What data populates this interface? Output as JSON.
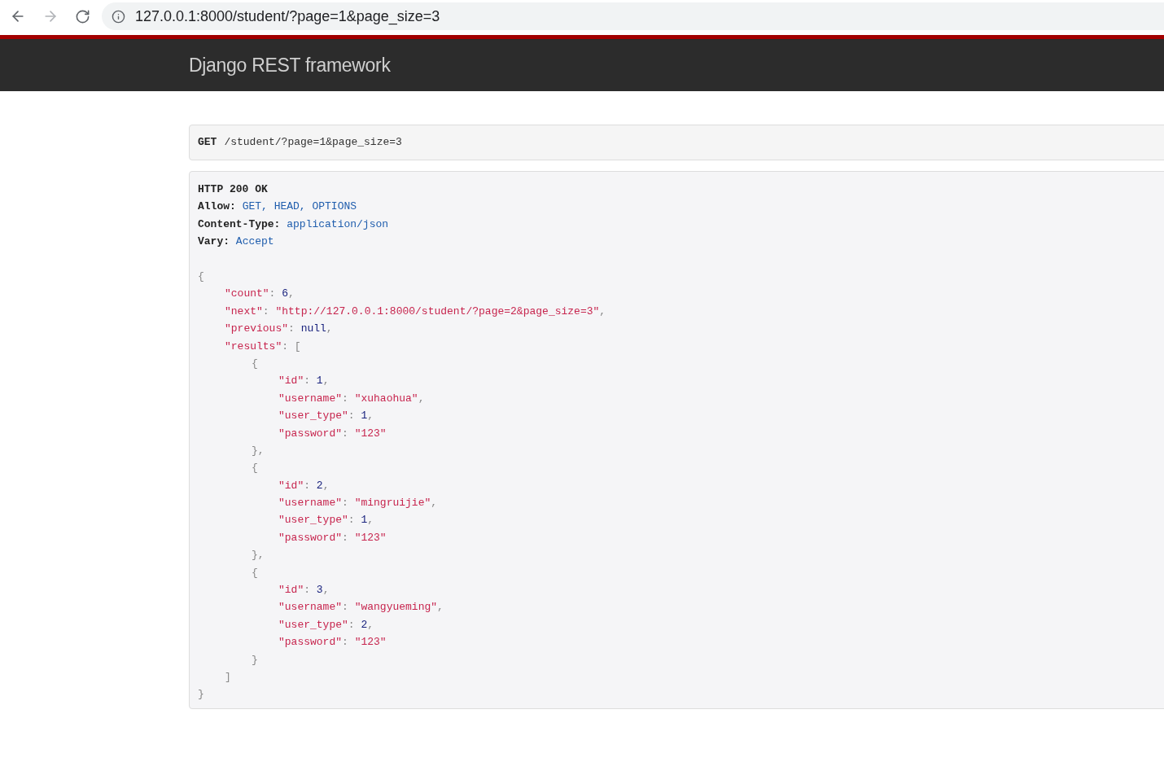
{
  "browser": {
    "url": "127.0.0.1:8000/student/?page=1&page_size=3"
  },
  "navbar": {
    "brand": "Django REST framework"
  },
  "request": {
    "method": "GET",
    "path": "/student/?page=1&page_size=3"
  },
  "response": {
    "status": "HTTP 200 OK",
    "headers": [
      {
        "name": "Allow:",
        "value": "GET, HEAD, OPTIONS"
      },
      {
        "name": "Content-Type:",
        "value": "application/json"
      },
      {
        "name": "Vary:",
        "value": "Accept"
      }
    ],
    "body": [
      {
        "tokens": [
          {
            "t": "{",
            "kind": "punct"
          }
        ],
        "children": [
          {
            "tokens": [
              {
                "t": "\"count\"",
                "kind": "key"
              },
              {
                "t": ": ",
                "kind": "punct"
              },
              {
                "t": "6",
                "kind": "num"
              },
              {
                "t": ",",
                "kind": "punct"
              }
            ]
          },
          {
            "tokens": [
              {
                "t": "\"next\"",
                "kind": "key"
              },
              {
                "t": ": ",
                "kind": "punct"
              },
              {
                "t": "\"http://127.0.0.1:8000/student/?page=2&page_size=3\"",
                "kind": "str"
              },
              {
                "t": ",",
                "kind": "punct"
              }
            ]
          },
          {
            "tokens": [
              {
                "t": "\"previous\"",
                "kind": "key"
              },
              {
                "t": ": ",
                "kind": "punct"
              },
              {
                "t": "null",
                "kind": "num"
              },
              {
                "t": ",",
                "kind": "punct"
              }
            ]
          },
          {
            "tokens": [
              {
                "t": "\"results\"",
                "kind": "key"
              },
              {
                "t": ": [",
                "kind": "punct"
              }
            ],
            "children": [
              {
                "tokens": [
                  {
                    "t": "{",
                    "kind": "punct"
                  }
                ],
                "children": [
                  {
                    "tokens": [
                      {
                        "t": "\"id\"",
                        "kind": "key"
                      },
                      {
                        "t": ": ",
                        "kind": "punct"
                      },
                      {
                        "t": "1",
                        "kind": "num"
                      },
                      {
                        "t": ",",
                        "kind": "punct"
                      }
                    ]
                  },
                  {
                    "tokens": [
                      {
                        "t": "\"username\"",
                        "kind": "key"
                      },
                      {
                        "t": ": ",
                        "kind": "punct"
                      },
                      {
                        "t": "\"xuhaohua\"",
                        "kind": "str"
                      },
                      {
                        "t": ",",
                        "kind": "punct"
                      }
                    ]
                  },
                  {
                    "tokens": [
                      {
                        "t": "\"user_type\"",
                        "kind": "key"
                      },
                      {
                        "t": ": ",
                        "kind": "punct"
                      },
                      {
                        "t": "1",
                        "kind": "num"
                      },
                      {
                        "t": ",",
                        "kind": "punct"
                      }
                    ]
                  },
                  {
                    "tokens": [
                      {
                        "t": "\"password\"",
                        "kind": "key"
                      },
                      {
                        "t": ": ",
                        "kind": "punct"
                      },
                      {
                        "t": "\"123\"",
                        "kind": "str"
                      }
                    ]
                  }
                ]
              },
              {
                "tokens": [
                  {
                    "t": "},",
                    "kind": "punct"
                  }
                ]
              },
              {
                "tokens": [
                  {
                    "t": "{",
                    "kind": "punct"
                  }
                ],
                "children": [
                  {
                    "tokens": [
                      {
                        "t": "\"id\"",
                        "kind": "key"
                      },
                      {
                        "t": ": ",
                        "kind": "punct"
                      },
                      {
                        "t": "2",
                        "kind": "num"
                      },
                      {
                        "t": ",",
                        "kind": "punct"
                      }
                    ]
                  },
                  {
                    "tokens": [
                      {
                        "t": "\"username\"",
                        "kind": "key"
                      },
                      {
                        "t": ": ",
                        "kind": "punct"
                      },
                      {
                        "t": "\"mingruijie\"",
                        "kind": "str"
                      },
                      {
                        "t": ",",
                        "kind": "punct"
                      }
                    ]
                  },
                  {
                    "tokens": [
                      {
                        "t": "\"user_type\"",
                        "kind": "key"
                      },
                      {
                        "t": ": ",
                        "kind": "punct"
                      },
                      {
                        "t": "1",
                        "kind": "num"
                      },
                      {
                        "t": ",",
                        "kind": "punct"
                      }
                    ]
                  },
                  {
                    "tokens": [
                      {
                        "t": "\"password\"",
                        "kind": "key"
                      },
                      {
                        "t": ": ",
                        "kind": "punct"
                      },
                      {
                        "t": "\"123\"",
                        "kind": "str"
                      }
                    ]
                  }
                ]
              },
              {
                "tokens": [
                  {
                    "t": "},",
                    "kind": "punct"
                  }
                ]
              },
              {
                "tokens": [
                  {
                    "t": "{",
                    "kind": "punct"
                  }
                ],
                "children": [
                  {
                    "tokens": [
                      {
                        "t": "\"id\"",
                        "kind": "key"
                      },
                      {
                        "t": ": ",
                        "kind": "punct"
                      },
                      {
                        "t": "3",
                        "kind": "num"
                      },
                      {
                        "t": ",",
                        "kind": "punct"
                      }
                    ]
                  },
                  {
                    "tokens": [
                      {
                        "t": "\"username\"",
                        "kind": "key"
                      },
                      {
                        "t": ": ",
                        "kind": "punct"
                      },
                      {
                        "t": "\"wangyueming\"",
                        "kind": "str"
                      },
                      {
                        "t": ",",
                        "kind": "punct"
                      }
                    ]
                  },
                  {
                    "tokens": [
                      {
                        "t": "\"user_type\"",
                        "kind": "key"
                      },
                      {
                        "t": ": ",
                        "kind": "punct"
                      },
                      {
                        "t": "2",
                        "kind": "num"
                      },
                      {
                        "t": ",",
                        "kind": "punct"
                      }
                    ]
                  },
                  {
                    "tokens": [
                      {
                        "t": "\"password\"",
                        "kind": "key"
                      },
                      {
                        "t": ": ",
                        "kind": "punct"
                      },
                      {
                        "t": "\"123\"",
                        "kind": "str"
                      }
                    ]
                  }
                ]
              },
              {
                "tokens": [
                  {
                    "t": "}",
                    "kind": "punct"
                  }
                ]
              }
            ]
          },
          {
            "tokens": [
              {
                "t": "]",
                "kind": "punct"
              }
            ]
          }
        ]
      },
      {
        "tokens": [
          {
            "t": "}",
            "kind": "punct"
          }
        ]
      }
    ]
  }
}
